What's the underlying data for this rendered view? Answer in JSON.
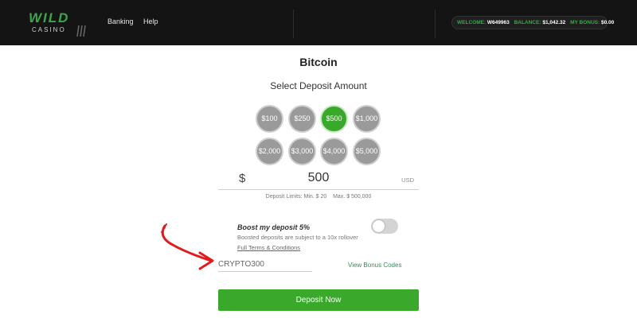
{
  "header": {
    "logo_top": "WILD",
    "logo_bottom": "CASINO",
    "nav": [
      "Banking",
      "Help"
    ],
    "account": {
      "welcome_label": "WELCOME:",
      "welcome_value": "W649963",
      "balance_label": "BALANCE:",
      "balance_value": "$1,042.32",
      "bonus_label": "MY BONUS:",
      "bonus_value": "$0.00"
    }
  },
  "main": {
    "title": "Bitcoin",
    "subtitle": "Select Deposit Amount",
    "amounts": [
      "$100",
      "$250",
      "$500",
      "$1,000",
      "$2,000",
      "$3,000",
      "$4,000",
      "$5,000"
    ],
    "selected_amount": "$500",
    "currency_symbol": "$",
    "amount_value": "500",
    "currency_code": "USD",
    "limits": "Deposit Limits: Min. $ 20    Max. $ 500,000",
    "boost": {
      "title": "Boost my deposit 5%",
      "note": "Boosted deposits are subject to a 10x rollover",
      "terms": "Full Terms & Conditions",
      "enabled": false
    },
    "bonus_code_value": "CRYPTO300",
    "view_bonus_codes": "View Bonus Codes",
    "deposit_button": "Deposit Now"
  },
  "colors": {
    "header_bg": "#141414",
    "brand_green": "#3aa84a",
    "active_green": "#3aa82a",
    "amount_grey": "#9a9a9a",
    "annotation_arrow": "#e01c1c"
  },
  "icons": {
    "logo_claws": "claw-marks-icon",
    "annotation": "red-arrow-icon"
  }
}
